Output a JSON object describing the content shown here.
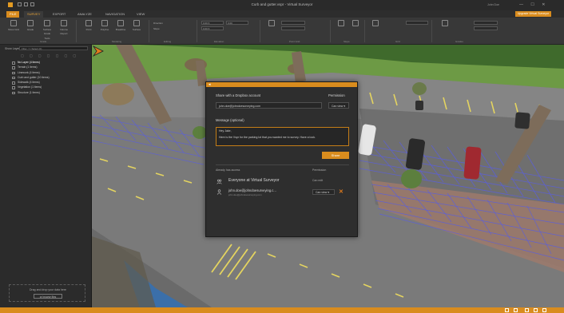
{
  "app": {
    "title": "Curb and gutter.vspr - Virtual Surveyor",
    "user": "John Doe",
    "window_controls": "— ☐ ✕"
  },
  "tabs": {
    "file": "FILE",
    "items": [
      "SURVEY",
      "EXPORT",
      "ANALYZE",
      "NAVIGATION",
      "VIEW"
    ],
    "upgrade": "Upgrade Virtual Surveyor"
  },
  "ribbon": {
    "buttons": [
      {
        "label": "Show Grid",
        "icon": "grid-icon"
      },
      {
        "label": "Grade",
        "icon": "grade-icon"
      },
      {
        "label": "Surface Grade Tools",
        "icon": "surface-icon"
      },
      {
        "label": "Volume Report",
        "icon": "volume-icon"
      },
      {
        "label": "Point",
        "icon": "point-icon"
      },
      {
        "label": "Polyline",
        "icon": "polyline-icon"
      },
      {
        "label": "Breakline",
        "icon": "breakline-icon"
      },
      {
        "label": "Surface",
        "icon": "surface-edit-icon"
      }
    ],
    "groups": [
      "Grade",
      "Modeling",
      "Editing",
      "Elevation",
      "Point Grid",
      "Slope",
      "Grid",
      "Layer Tools",
      "Grades"
    ],
    "fields": {
      "direction": "Direction",
      "slope": "Slope",
      "value1": "0.00 ft",
      "value2": "0.00 ft",
      "value3": "0.00"
    }
  },
  "left_panel": {
    "header": "Show Layers",
    "search_placeholder": "Filter: 7 / Select (0)",
    "tools": "▢ ▢ ▢ ▢ ▢ ▢ ▢",
    "layers": [
      "No Layer   (4 items)",
      "Terrain   (1 items)",
      "Linework   (4 items)",
      "Curb and gutter   (10 items)",
      "Sidewalk   (4 items)",
      "Vegetation   (1 items)",
      "Structure   (1 items)"
    ],
    "drop_zone": {
      "text": "Drag and drop your data here",
      "button": "or browse files"
    }
  },
  "share_dialog": {
    "share_label": "Share with a Dropbox account",
    "email_value": "john.doe@johndoesurveying.com",
    "permission_label": "Permission",
    "permission_value": "Can view",
    "message_label": "Message (optional)",
    "message_lines": [
      "Hey Jake,",
      "Here is the Vspr for the parking lot that you wanted me to survey. Have a look."
    ],
    "share_button": "Share",
    "access_label": "Already has access",
    "access_permission_label": "Permission",
    "access_rows": [
      {
        "name": "Everyone at Virtual Surveyor",
        "permission": "Can edit",
        "icon": "group-icon"
      },
      {
        "name": "john.doe@johndoesurveying.c...",
        "sub": "john.doe@johndoesurveying.com",
        "permission": "Can view",
        "icon": "user-icon"
      }
    ]
  },
  "colors": {
    "accent": "#d98c1e",
    "ribbon": "#383838",
    "panel": "#2b2b2b"
  }
}
